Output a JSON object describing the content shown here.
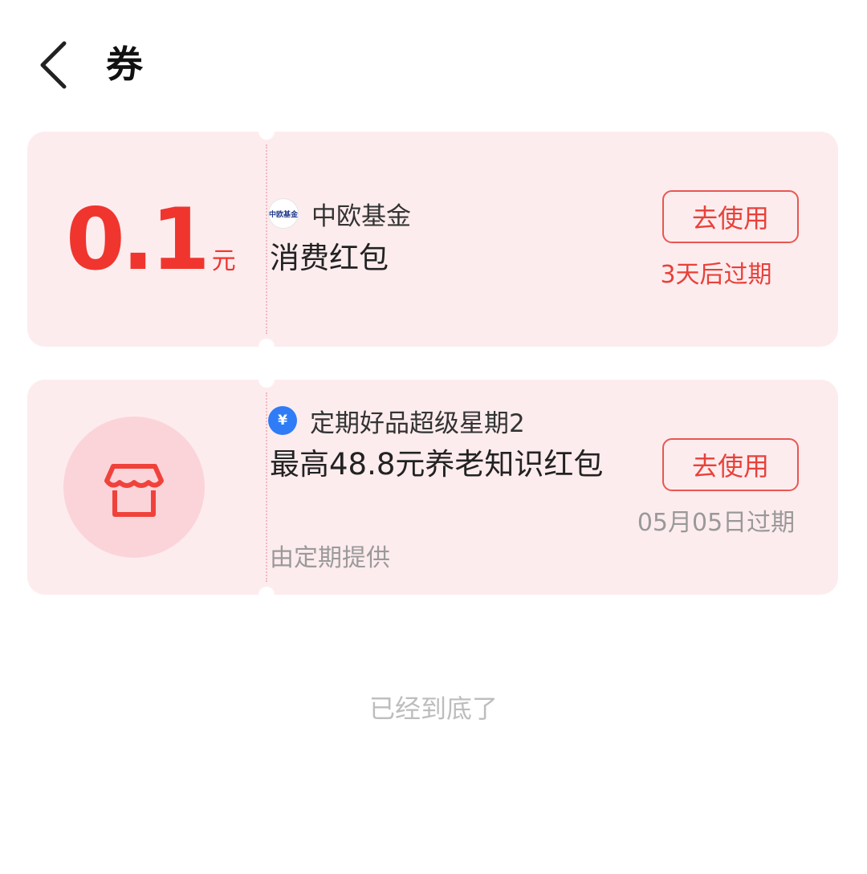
{
  "header": {
    "title": "券",
    "back_icon": "chevron-left-icon"
  },
  "coupons": [
    {
      "amount": "0.1",
      "unit": "元",
      "brand": "中欧基金",
      "brand_logo_text": "中欧基金",
      "name": "消费红包",
      "action": "去使用",
      "expiry": "3天后过期"
    },
    {
      "icon": "store-icon",
      "brand": "定期好品超级星期2",
      "brand_logo_text": "¥",
      "name": "最高48.8元养老知识红包",
      "provider": "由定期提供",
      "action": "去使用",
      "expiry": "05月05日过期"
    }
  ],
  "footer": {
    "end_text": "已经到底了"
  },
  "colors": {
    "accent": "#f0352e",
    "card_bg": "#fdecee",
    "muted": "#999999"
  }
}
